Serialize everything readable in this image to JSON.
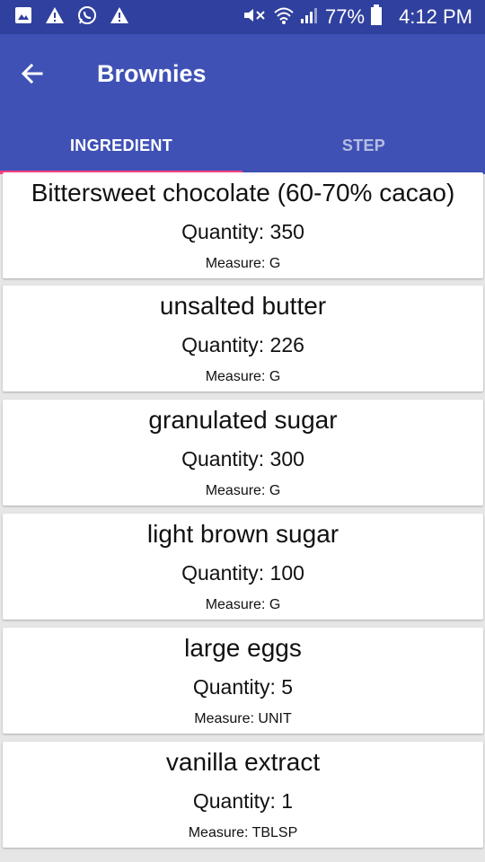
{
  "status_bar": {
    "icons": [
      "image-icon",
      "warning-icon",
      "whatsapp-icon",
      "warning-icon",
      "mute-icon",
      "wifi-icon",
      "signal-icon",
      "battery-icon"
    ],
    "battery": "77%",
    "time": "4:12 PM"
  },
  "app_bar": {
    "title": "Brownies",
    "back_icon": "arrow-back-icon"
  },
  "tabs": [
    {
      "label": "INGREDIENT",
      "selected": true
    },
    {
      "label": "STEP",
      "selected": false
    }
  ],
  "ingredients": [
    {
      "name": "Bittersweet chocolate (60-70% cacao)",
      "quantity": "Quantity: 350",
      "measure": "Measure: G"
    },
    {
      "name": "unsalted butter",
      "quantity": "Quantity: 226",
      "measure": "Measure: G"
    },
    {
      "name": "granulated sugar",
      "quantity": "Quantity: 300",
      "measure": "Measure: G"
    },
    {
      "name": "light brown sugar",
      "quantity": "Quantity: 100",
      "measure": "Measure: G"
    },
    {
      "name": "large eggs",
      "quantity": "Quantity: 5",
      "measure": "Measure: UNIT"
    },
    {
      "name": "vanilla extract",
      "quantity": "Quantity: 1",
      "measure": "Measure: TBLSP"
    }
  ],
  "colors": {
    "primary": "#3f51b5",
    "primary_dark": "#30409e",
    "accent": "#ff4081"
  }
}
